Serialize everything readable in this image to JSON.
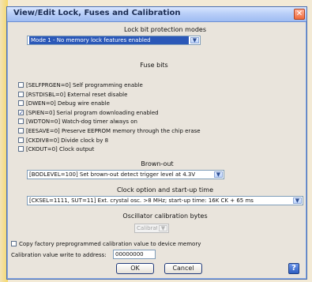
{
  "window": {
    "title": "View/Edit Lock, Fuses and Calibration",
    "close_glyph": "✕"
  },
  "lock": {
    "label": "Lock bit protection modes",
    "selected": "Mode 1 - No memory lock features enabled"
  },
  "fuses": {
    "label": "Fuse bits",
    "items": [
      {
        "label": "[SELFPRGEN=0] Self programming enable",
        "checked": false
      },
      {
        "label": "[RSTDISBL=0] External reset disable",
        "checked": false
      },
      {
        "label": "[DWEN=0] Debug wire enable",
        "checked": false
      },
      {
        "label": "[SPIEN=0] Serial program downloading enabled",
        "checked": true
      },
      {
        "label": "[WDTON=0] Watch-dog timer always on",
        "checked": false
      },
      {
        "label": "[EESAVE=0] Preserve EEPROM memory through the chip erase",
        "checked": false
      },
      {
        "label": "[CKDIV8=0] Divide clock by 8",
        "checked": false
      },
      {
        "label": "[CKOUT=0] Clock output",
        "checked": false
      }
    ]
  },
  "brownout": {
    "label": "Brown-out",
    "selected": "[BODLEVEL=100] Set brown-out detect trigger level at 4.3V"
  },
  "clock": {
    "label": "Clock option and start-up time",
    "selected": "[CKSEL=1111, SUT=11] Ext. crystal osc. >8 MHz; start-up time: 16K CK + 65 ms"
  },
  "oscillator": {
    "label": "Oscillator calibration bytes",
    "selected": "Calibration value"
  },
  "copy_option": {
    "label": "Copy factory preprogrammed calibration value to device memory",
    "checked": false
  },
  "address": {
    "label": "Calibration value write to address:",
    "value": "00000000"
  },
  "buttons": {
    "ok": "OK",
    "cancel": "Cancel",
    "help": "?"
  },
  "ui": {
    "dropdown_glyph": "▼",
    "check_glyph": "✓"
  }
}
